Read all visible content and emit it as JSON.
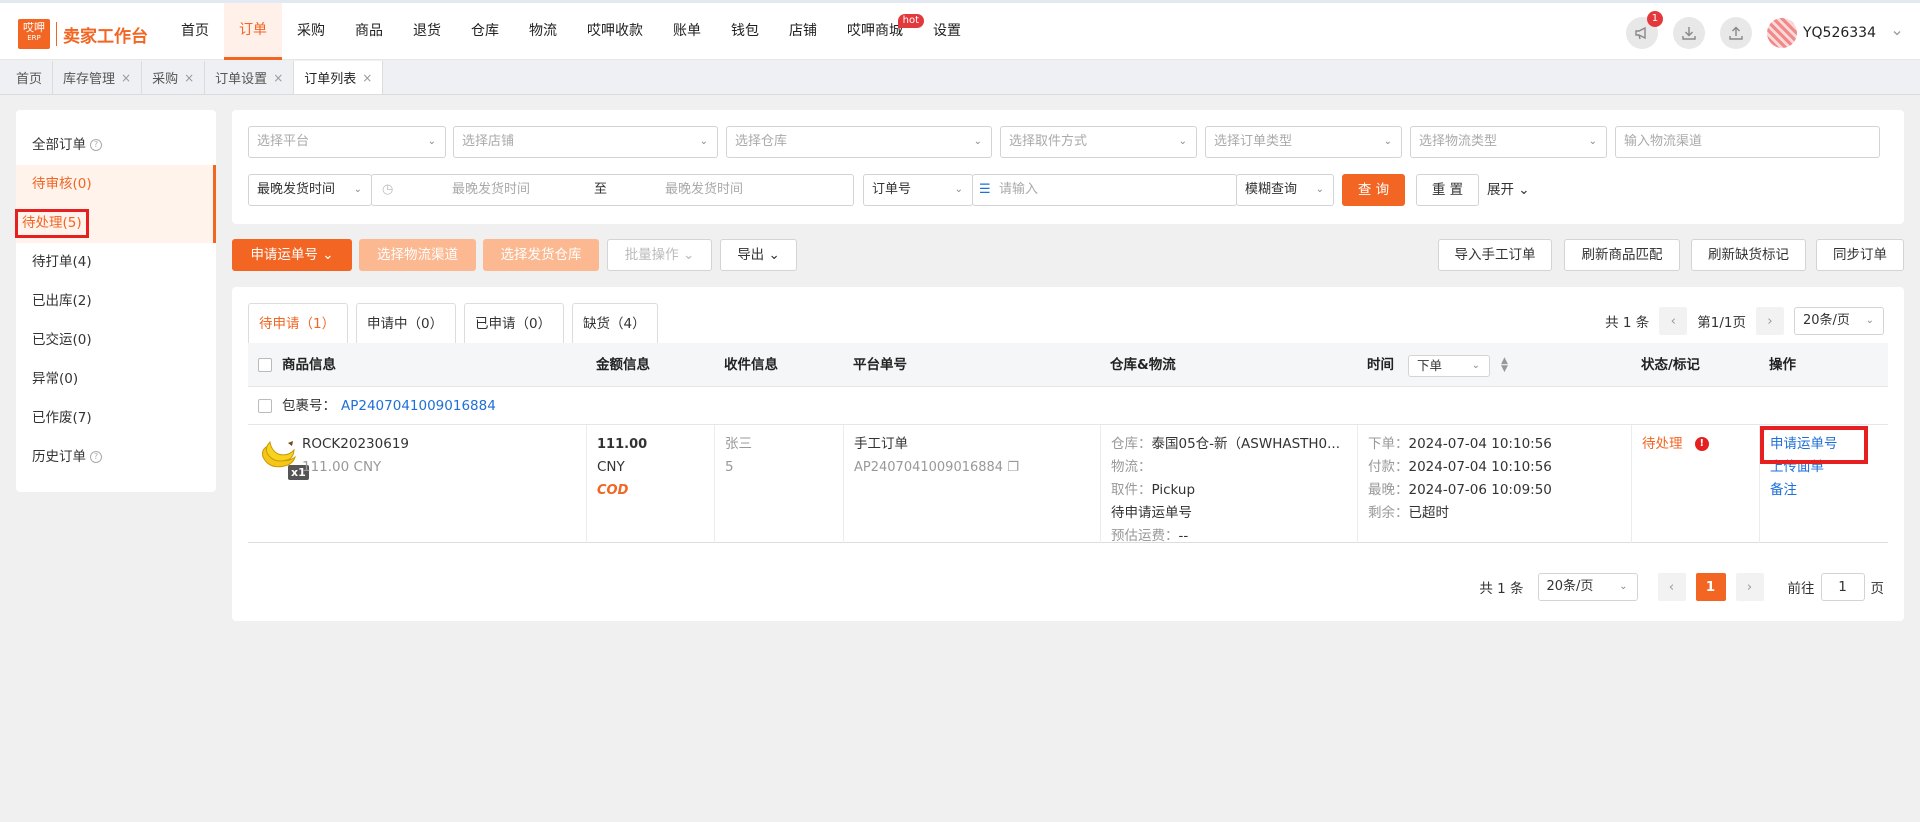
{
  "app": {
    "logo_icon_text": "哎呷",
    "logo_icon_sub": "ERP",
    "logo_text": "卖家工作台",
    "nav": [
      {
        "label": "首页"
      },
      {
        "label": "订单"
      },
      {
        "label": "采购"
      },
      {
        "label": "商品"
      },
      {
        "label": "退货"
      },
      {
        "label": "仓库"
      },
      {
        "label": "物流"
      },
      {
        "label": "哎呷收款"
      },
      {
        "label": "账单"
      },
      {
        "label": "钱包"
      },
      {
        "label": "店铺"
      },
      {
        "label": "哎呷商城"
      },
      {
        "label": "设置"
      }
    ],
    "active_nav": "订单",
    "hot_badge": "hot",
    "notification_count": "1",
    "username": "YQ526334",
    "accent_color": "#f26522"
  },
  "tabs": [
    {
      "label": "首页",
      "closable": false
    },
    {
      "label": "库存管理",
      "closable": true
    },
    {
      "label": "采购",
      "closable": true
    },
    {
      "label": "订单设置",
      "closable": true
    },
    {
      "label": "订单列表",
      "closable": true
    }
  ],
  "close_glyph": "×",
  "sidebar": {
    "items": [
      {
        "label": "全部订单"
      },
      {
        "label": "待审核(0)"
      },
      {
        "label": "待处理(5)"
      },
      {
        "label": "待打单(4)"
      },
      {
        "label": "已出库(2)"
      },
      {
        "label": "已交运(0)"
      },
      {
        "label": "异常(0)"
      },
      {
        "label": "已作废(7)"
      },
      {
        "label": "历史订单"
      }
    ],
    "active": "待处理(5)"
  },
  "filters": {
    "platform": "选择平台",
    "shop": "选择店铺",
    "warehouse": "选择仓库",
    "pickup": "选择取件方式",
    "order_type": "选择订单类型",
    "logistics_type": "选择物流类型",
    "channel_placeholder": "输入物流渠道",
    "time_type": "最晚发货时间",
    "time_start": "最晚发货时间",
    "time_to": "至",
    "time_end": "最晚发货时间",
    "field_type": "订单号",
    "search_placeholder": "请输入",
    "match_type": "模糊查询",
    "query_btn": "查 询",
    "reset_btn": "重 置",
    "expand_btn": "展开"
  },
  "actions": {
    "apply_tracking": "申请运单号",
    "choose_channel": "选择物流渠道",
    "choose_warehouse": "选择发货仓库",
    "batch": "批量操作",
    "export": "导出",
    "import_manual": "导入手工订单",
    "refresh_match": "刷新商品匹配",
    "refresh_stockout": "刷新缺货标记",
    "sync_orders": "同步订单"
  },
  "subtabs": [
    {
      "label": "待申请（1）"
    },
    {
      "label": "申请中（0）"
    },
    {
      "label": "已申请（0）"
    },
    {
      "label": "缺货（4）"
    }
  ],
  "pager_top": {
    "total": "共 1 条",
    "page": "第1/1页",
    "size": "20条/页"
  },
  "table": {
    "headers": {
      "product": "商品信息",
      "amount": "金额信息",
      "receiver": "收件信息",
      "platform_no": "平台单号",
      "warehouse": "仓库&物流",
      "time": "时间",
      "time_select": "下单",
      "status": "状态/标记",
      "ops": "操作"
    },
    "package_label": "包裹号：",
    "package_no": "AP2407041009016884",
    "rows": [
      {
        "sku": "ROCK20230619",
        "price": "111.00 CNY",
        "qty": "x1",
        "amount": "111.00",
        "currency": "CNY",
        "payment": "COD",
        "receiver_name": "张三",
        "receiver_info": "5",
        "platform_type": "手工订单",
        "platform_no": "AP2407041009016884",
        "warehouse": "仓库：",
        "warehouse_val": "泰国05仓-新（ASWHASTH0...",
        "logistics": "物流：",
        "pickup": "取件：",
        "pickup_val": "Pickup",
        "pending": "待申请运单号",
        "est_fee": "预估运费：",
        "est_fee_val": "--",
        "order_time_label": "下单：",
        "order_time": "2024-07-04 10:10:56",
        "pay_time_label": "付款：",
        "pay_time": "2024-07-04 10:10:56",
        "latest_label": "最晚：",
        "latest": "2024-07-06 10:09:50",
        "remain_label": "剩余：",
        "remain": "已超时",
        "status": "待处理",
        "op1": "申请运单号",
        "op2": "上传面单",
        "op3": "备注"
      }
    ]
  },
  "pager_bottom": {
    "total": "共 1 条",
    "size": "20条/页",
    "current": "1",
    "goto_label": "前往",
    "goto_value": "1",
    "page_unit": "页"
  }
}
